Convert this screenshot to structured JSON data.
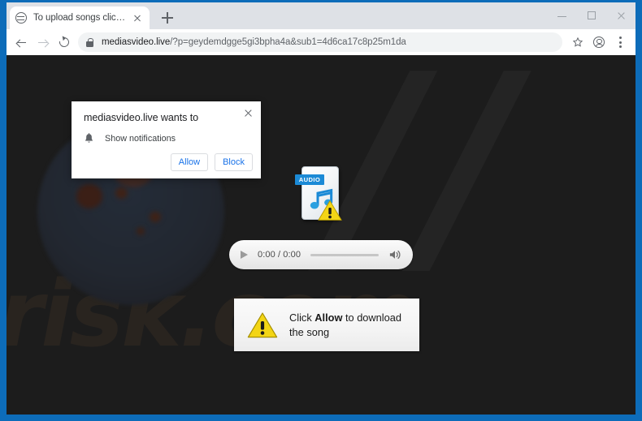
{
  "browser": {
    "tab": {
      "title": "To upload songs click Allow",
      "favicon": "globe-icon",
      "close": "x"
    },
    "new_tab_label": "+",
    "window_controls": {
      "minimize": "minimize-icon",
      "maximize": "maximize-icon",
      "close": "close-icon"
    },
    "toolbar": {
      "back": "back-arrow-icon",
      "forward": "forward-arrow-icon",
      "reload": "reload-icon",
      "lock": "lock-icon",
      "url_host": "mediasvideo.live",
      "url_path": "/?p=geydemdgge5gi3bpha4a&sub1=4d6ca17c8p25m1da",
      "bookmark": "star-icon",
      "profile": "profile-avatar-icon",
      "menu": "kebab-menu-icon"
    }
  },
  "permission_dialog": {
    "title": "mediasvideo.live wants to",
    "permission_icon": "bell-icon",
    "permission_label": "Show notifications",
    "allow_label": "Allow",
    "block_label": "Block",
    "close_label": "x"
  },
  "page": {
    "background_color": "#1c1c1c",
    "watermark_text": "risk.com",
    "audio_icon": {
      "badge": "AUDIO",
      "note_icon": "music-note-icon",
      "warning_icon": "warning-triangle-icon",
      "badge_color": "#1b8ad6"
    },
    "audio_player": {
      "play_icon": "play-icon",
      "time": "0:00 / 0:00",
      "volume_icon": "volume-icon",
      "progress_percent": 0
    },
    "banner": {
      "warning_icon": "warning-triangle-icon",
      "text_before": "Click ",
      "text_bold": "Allow",
      "text_after": " to download",
      "text_line2": "the song",
      "warning_color": "#f2d014"
    }
  }
}
